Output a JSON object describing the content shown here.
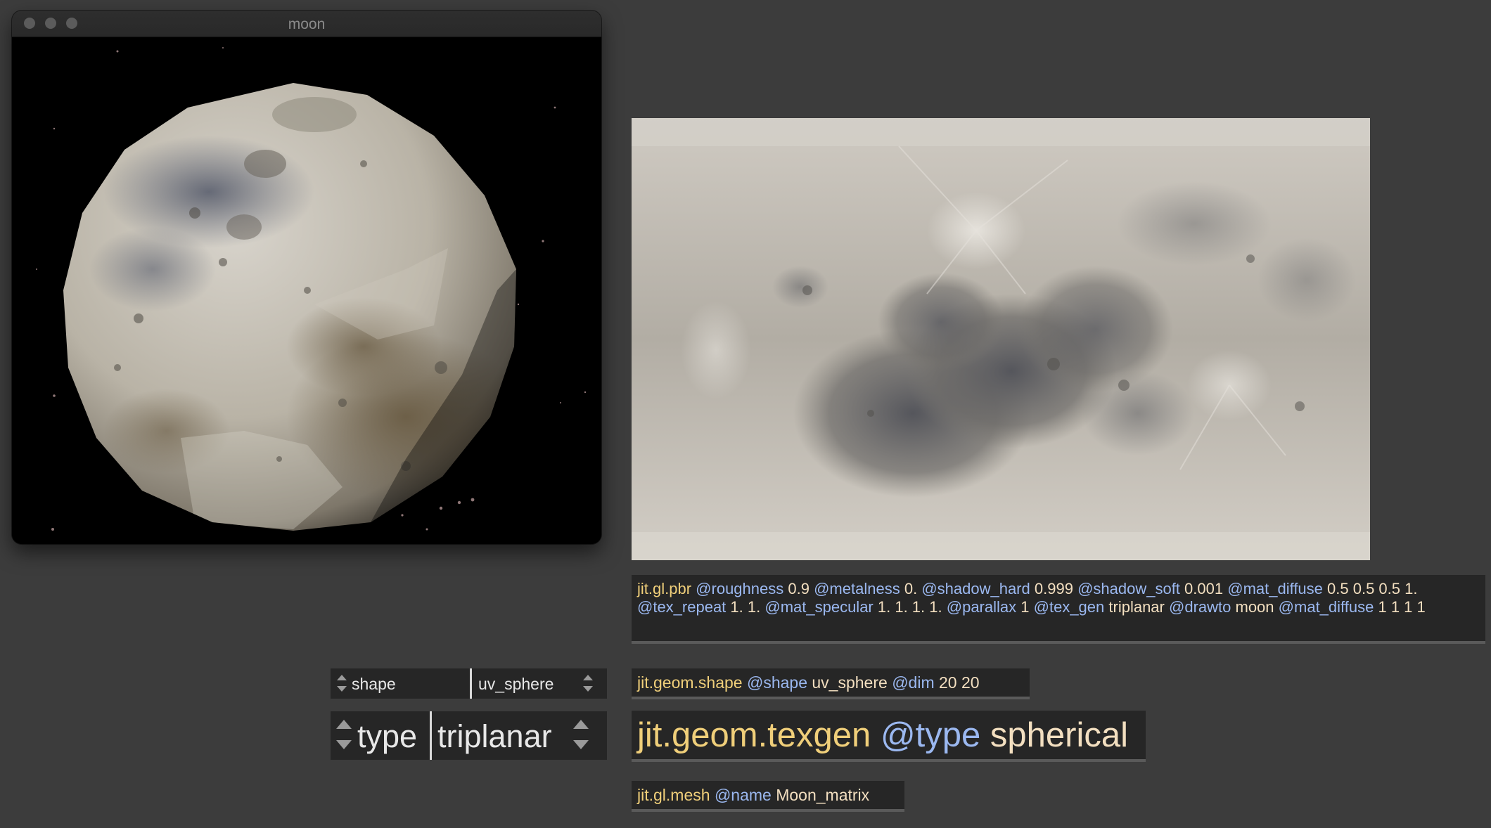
{
  "window": {
    "title": "moon",
    "viewport_content": "textured moon sphere on starfield"
  },
  "texture_preview": {
    "content": "equirectangular moon texture map"
  },
  "objects": {
    "pbr": {
      "class": "jit.gl.pbr",
      "args": [
        {
          "attr": "@roughness",
          "val": "0.9"
        },
        {
          "attr": "@metalness",
          "val": "0."
        },
        {
          "attr": "@shadow_hard",
          "val": "0.999"
        },
        {
          "attr": "@shadow_soft",
          "val": "0.001"
        },
        {
          "attr": "@mat_diffuse",
          "val": "0.5 0.5 0.5 1."
        },
        {
          "attr": "@tex_repeat",
          "val": "1. 1."
        },
        {
          "attr": "@mat_specular",
          "val": "1. 1. 1. 1."
        },
        {
          "attr": "@parallax",
          "val": "1"
        },
        {
          "attr": "@tex_gen",
          "val": "triplanar"
        },
        {
          "attr": "@drawto",
          "val": "moon"
        },
        {
          "attr": "@mat_diffuse",
          "val": "1 1 1 1"
        }
      ]
    },
    "shape": {
      "class": "jit.geom.shape",
      "args": [
        {
          "attr": "@shape",
          "val": "uv_sphere"
        },
        {
          "attr": "@dim",
          "val": "20 20"
        }
      ]
    },
    "texgen": {
      "class": "jit.geom.texgen",
      "args": [
        {
          "attr": "@type",
          "val": "spherical"
        }
      ]
    },
    "mesh": {
      "class": "jit.gl.mesh",
      "args": [
        {
          "attr": "@name",
          "val": "Moon_matrix"
        }
      ]
    }
  },
  "attrui": {
    "shape": {
      "name": "shape",
      "value": "uv_sphere"
    },
    "type": {
      "name": "type",
      "value": "triplanar"
    }
  },
  "colors": {
    "background": "#3c3c3c",
    "object_bg": "#262626",
    "class_text": "#f0cf7a",
    "attr_text": "#9bb8f0",
    "value_text": "#f3dfc0"
  }
}
